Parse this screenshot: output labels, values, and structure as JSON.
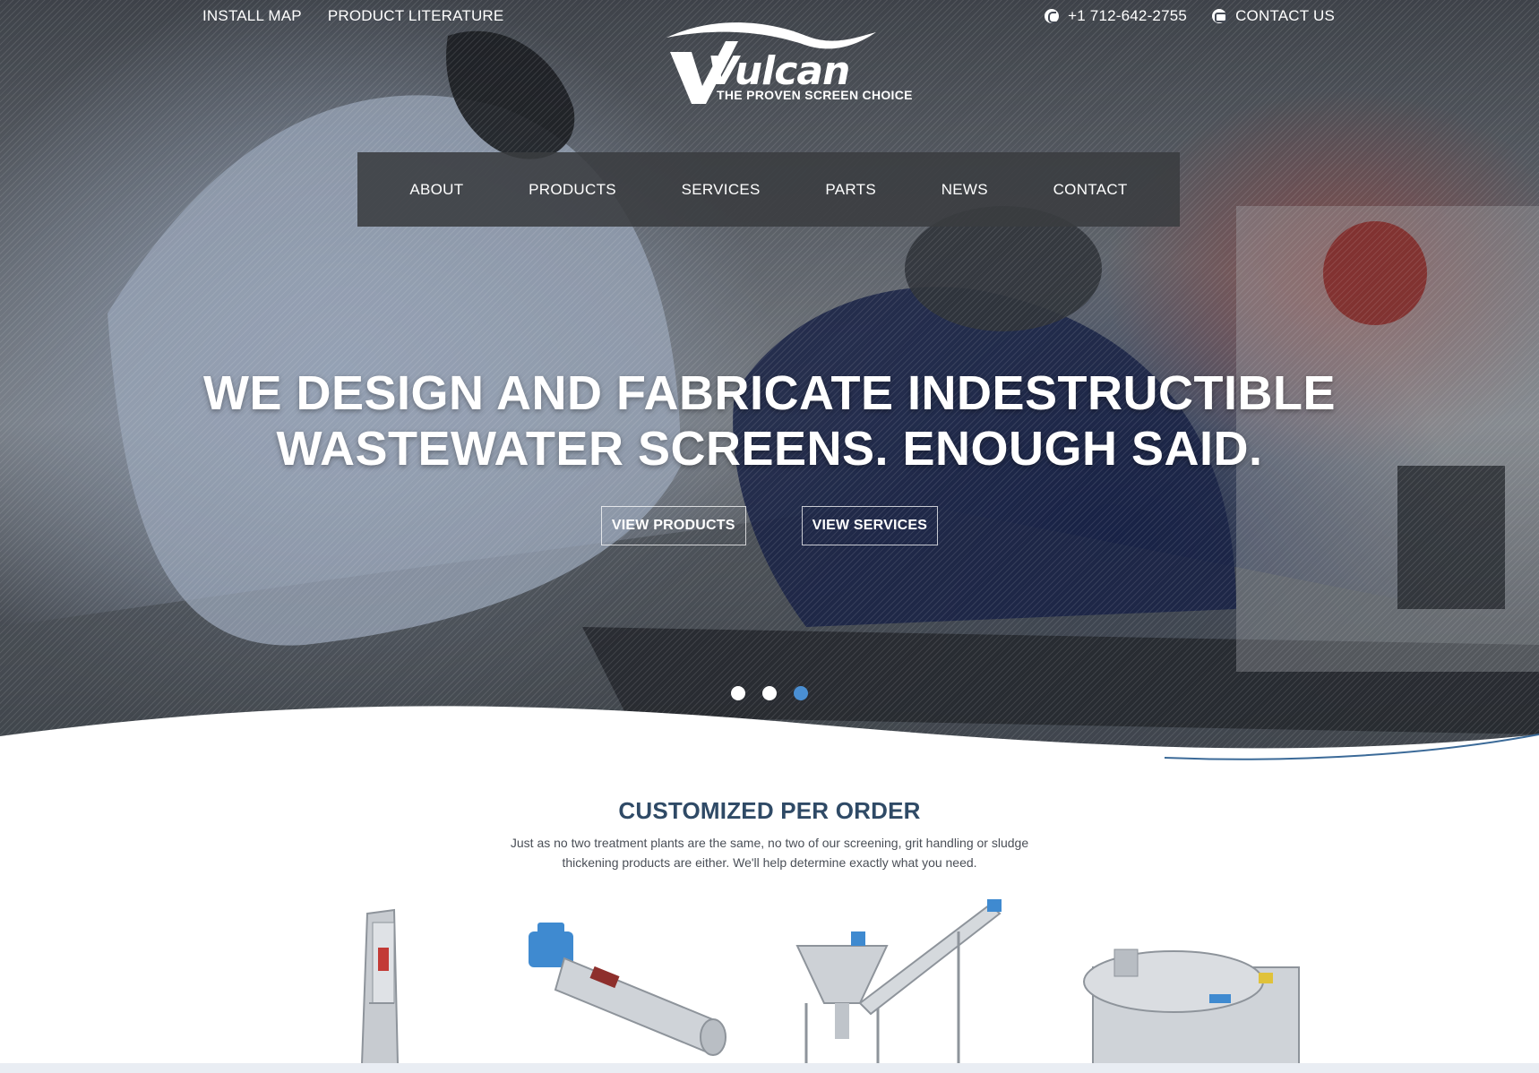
{
  "utility_nav": {
    "install_map": "INSTALL MAP",
    "product_literature": "PRODUCT LITERATURE",
    "phone": "+1 712-642-2755",
    "contact_us": "CONTACT US"
  },
  "logo": {
    "wordmark": "Vulcan",
    "tagline": "THE PROVEN SCREEN CHOICE"
  },
  "main_nav": {
    "items": [
      "ABOUT",
      "PRODUCTS",
      "SERVICES",
      "PARTS",
      "NEWS",
      "CONTACT"
    ]
  },
  "hero": {
    "headline_line1": "WE DESIGN AND FABRICATE INDESTRUCTIBLE",
    "headline_line2": "WASTEWATER SCREENS. ENOUGH SAID.",
    "cta_products": "VIEW PRODUCTS",
    "cta_services": "VIEW SERVICES",
    "slides_total": 3,
    "active_slide": 3
  },
  "section": {
    "title": "CUSTOMIZED PER ORDER",
    "description": "Just as no two treatment plants are the same, no two of our screening, grit handling or sludge thickening products are either. We'll help determine exactly what you need."
  },
  "colors": {
    "accent_blue": "#4a8fd3",
    "title_navy": "#2f4a66",
    "nav_bg": "#3a3c40"
  },
  "icons": {
    "phone": "phone-icon",
    "contact": "chat-icon"
  }
}
